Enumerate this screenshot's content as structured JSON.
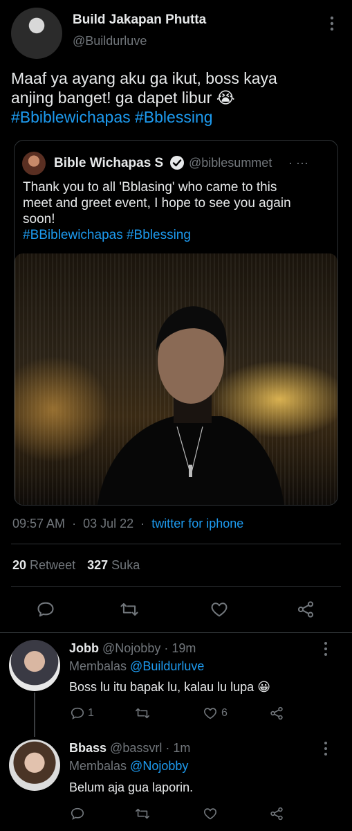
{
  "tweet": {
    "author_name": "Build Jakapan Phutta",
    "author_handle": "@Buildurluve",
    "text_line1": "Maaf ya ayang aku ga ikut, boss kaya",
    "text_line2_prefix": "anjing banget! ga dapet libur",
    "text_line2_emoji": "😭",
    "hashtags": "#Bbiblewichapas #Bblessing",
    "time": "09:57 AM",
    "date": "03 Jul 22",
    "source": "twitter for iphone",
    "retweet_count": "20",
    "retweet_label": "Retweet",
    "like_count": "327",
    "like_label": "Suka",
    "dot": "·"
  },
  "quoted": {
    "author_name": "Bible Wichapas S",
    "author_handle": "@biblesummet",
    "more": "· ···",
    "text_line1": "Thank you to all 'Bblasing' who came to this",
    "text_line2": "meet and greet event, I hope to see you again",
    "text_line3": "soon!",
    "hashtags": "#BBiblewichapas #Bblessing"
  },
  "replies": [
    {
      "name": "Jobb",
      "handle": "@Nojobby",
      "time": "· 19m",
      "replying_label": "Membalas",
      "replying_to": "@Buildurluve",
      "text": "Boss lu itu bapak lu, kalau lu lupa",
      "emoji": "😀",
      "reply_count": "1",
      "like_count": "6"
    },
    {
      "name": "Bbass",
      "handle": "@bassvrl",
      "time": "· 1m",
      "replying_label": "Membalas",
      "replying_to": "@Nojobby",
      "text": "Belum aja gua laporin.",
      "reply_count": "",
      "like_count": ""
    }
  ],
  "colors": {
    "background": "#000000",
    "text": "#e7e9ea",
    "muted": "#71767b",
    "accent": "#1d9bf0",
    "divider": "#2f3336"
  }
}
